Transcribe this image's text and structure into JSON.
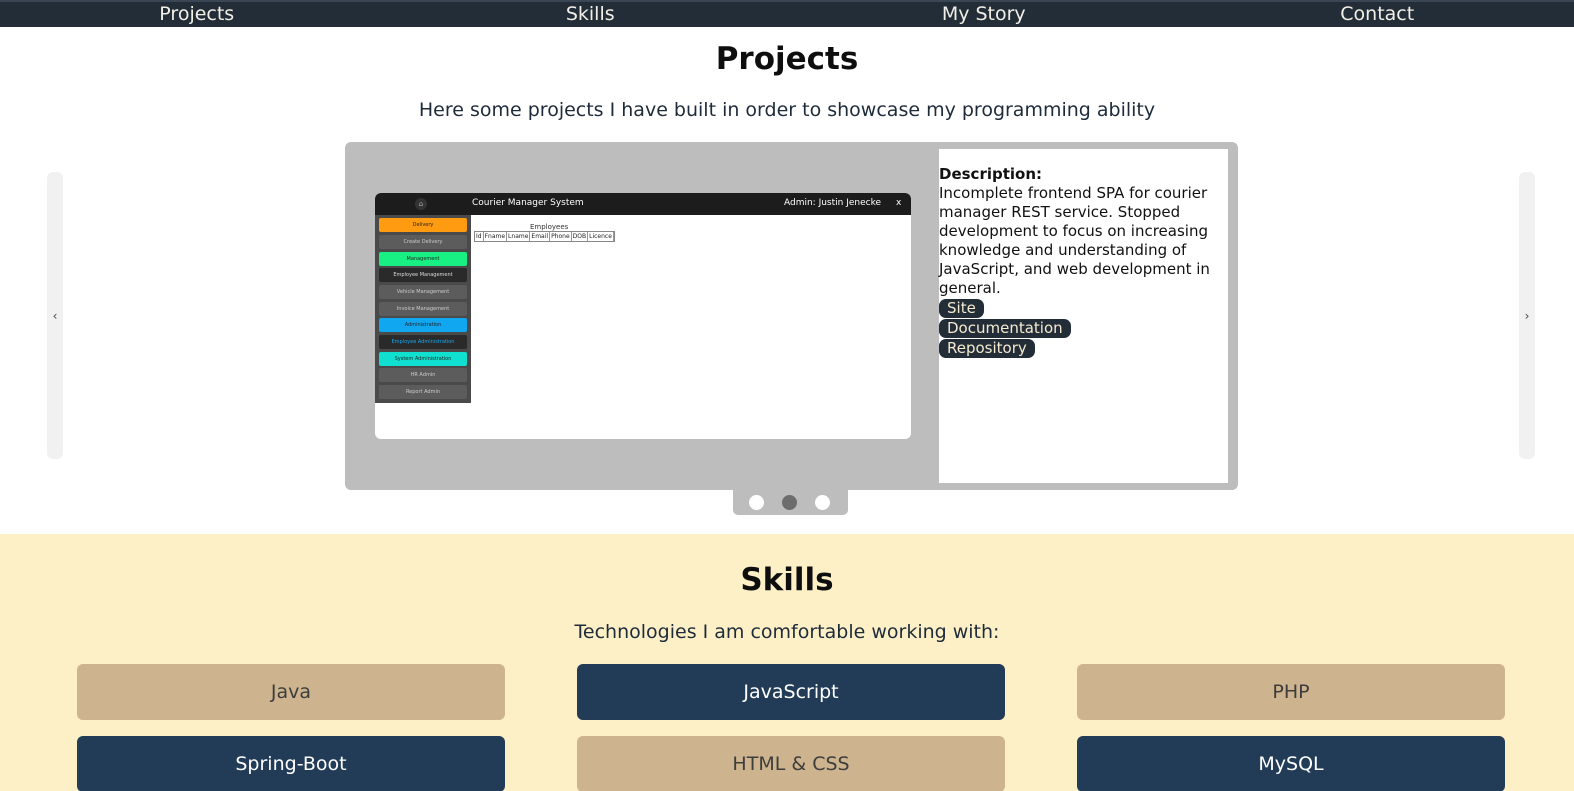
{
  "nav": {
    "items": [
      {
        "label": "Projects"
      },
      {
        "label": "Skills"
      },
      {
        "label": "My Story"
      },
      {
        "label": "Contact"
      }
    ]
  },
  "projects": {
    "title": "Projects",
    "subtitle": "Here some projects I have built in order to showcase my programming ability",
    "prev_arrow": "‹",
    "next_arrow": "›",
    "slide": {
      "screenshot": {
        "window_title": "Courier Manager System",
        "admin_label": "Admin: Justin Jenecke",
        "close_label": "x",
        "home_icon": "⌂",
        "sidebar": [
          {
            "label": "Delivery",
            "color": "#ff9b10"
          },
          {
            "label": "Create Delivery",
            "color": "#5c5c5c"
          },
          {
            "label": "Management",
            "color": "#19f083"
          },
          {
            "label": "Employee Management",
            "color": "#2a2a2a"
          },
          {
            "label": "Vehicle Management",
            "color": "#5c5c5c"
          },
          {
            "label": "Invoice Management",
            "color": "#5c5c5c"
          },
          {
            "label": "Administration",
            "color": "#10a7f0"
          },
          {
            "label": "Employee Administration",
            "color": "#2a2a2a"
          },
          {
            "label": "System Administration",
            "color": "#10e0d0"
          },
          {
            "label": "HR Admin",
            "color": "#5c5c5c"
          },
          {
            "label": "Report Admin",
            "color": "#5c5c5c"
          }
        ],
        "table_caption": "Employees",
        "table_headers": [
          "Id",
          "Fname",
          "Lname",
          "Email",
          "Phone",
          "DOB",
          "Licence"
        ]
      },
      "description_label": "Description:",
      "description_text": "Incomplete frontend SPA for courier manager REST service. Stopped development to focus on increasing knowledge and understanding of JavaScript, and web development in general.",
      "links": [
        {
          "label": "Site"
        },
        {
          "label": "Documentation"
        },
        {
          "label": "Repository"
        }
      ]
    },
    "dots": {
      "count": 3,
      "active_index": 1
    }
  },
  "skills": {
    "title": "Skills",
    "subtitle": "Technologies I am comfortable working with:",
    "items": [
      {
        "label": "Java",
        "style": "tan"
      },
      {
        "label": "JavaScript",
        "style": "navy"
      },
      {
        "label": "PHP",
        "style": "tan"
      },
      {
        "label": "Spring-Boot",
        "style": "navy"
      },
      {
        "label": "HTML & CSS",
        "style": "tan"
      },
      {
        "label": "MySQL",
        "style": "navy"
      }
    ]
  },
  "colors": {
    "nav_bg": "#222d38",
    "skills_bg": "#fdf0c6",
    "tan": "#cdb48e",
    "navy": "#223c58",
    "slide_bg": "#bdbdbd"
  }
}
